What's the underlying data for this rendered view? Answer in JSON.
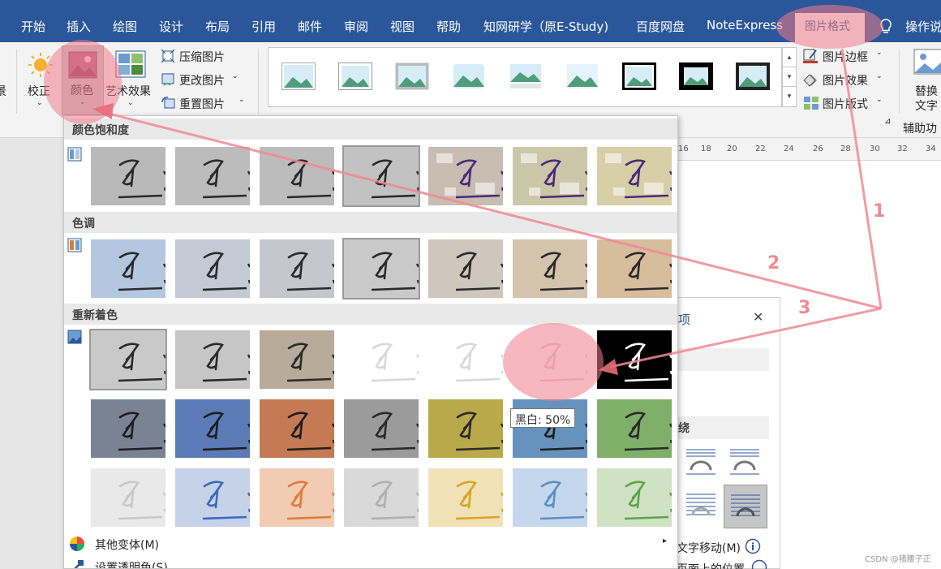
{
  "menu": {
    "tabs": [
      "开始",
      "插入",
      "绘图",
      "设计",
      "布局",
      "引用",
      "邮件",
      "审阅",
      "视图",
      "帮助",
      "知网研学（原E-Study)",
      "百度网盘",
      "NoteExpress"
    ],
    "active_tab": "图片格式",
    "lightbulb_icon": "lightbulb-icon",
    "tell_me": "操作说"
  },
  "ribbon": {
    "background_btn": "景",
    "corrections": "校正",
    "color": "颜色",
    "artistic_effects": "艺术效果",
    "compress": "压缩图片",
    "change": "更改图片",
    "reset": "重置图片",
    "picture_border": "图片边框",
    "picture_effects": "图片效果",
    "picture_layout": "图片版式",
    "alt_text_1": "替换",
    "alt_text_2": "文字",
    "accessibility": "辅助功"
  },
  "ruler": {
    "ticks": [
      "16",
      "18",
      "20",
      "22",
      "24",
      "26",
      "28",
      "30",
      "32",
      "34"
    ]
  },
  "dropdown": {
    "saturation_title": "颜色饱和度",
    "tone_title": "色调",
    "recolor_title": "重新着色",
    "more_variations": "其他变体(M)",
    "set_transparent": "设置透明色(S)",
    "tooltip": "黑白: 50%",
    "saturation_tints": [
      "#b9b9b9",
      "#bcbcbc",
      "#bcbcbc",
      "#c2c2c2",
      "#c8bdb0",
      "#ccc7a8",
      "#d6cfa8"
    ],
    "tone_tints": [
      "#b3c7e0",
      "#c3cad4",
      "#c4c8cc",
      "#c9c9c9",
      "#cfc6bc",
      "#d4c3ad",
      "#d6bd9c"
    ],
    "recolor_row1": [
      "#c9c9c9",
      "#c6c6c6",
      "#b8ab9a",
      "#ffffff",
      "#ffffff",
      "#ffffff",
      "#000000"
    ],
    "recolor_row2": [
      "#7a8394",
      "#5b7bb6",
      "#c57a54",
      "#9b9b9b",
      "#b9a94a",
      "#6693bd",
      "#7fb069"
    ],
    "recolor_row3": [
      "#e9e9e9",
      "#c6d2e8",
      "#f1ccb3",
      "#d9d9d9",
      "#f1e1b6",
      "#c4d7ec",
      "#cfe2c4"
    ]
  },
  "pane": {
    "title_fragment": "项",
    "close": "✕",
    "wrap_label": "绕",
    "move_with_text": "文字移动(M)",
    "position_on_page": "页面上的位置"
  },
  "annotations": [
    "1",
    "2",
    "3"
  ],
  "watermark": "CSDN @猪腰子正"
}
